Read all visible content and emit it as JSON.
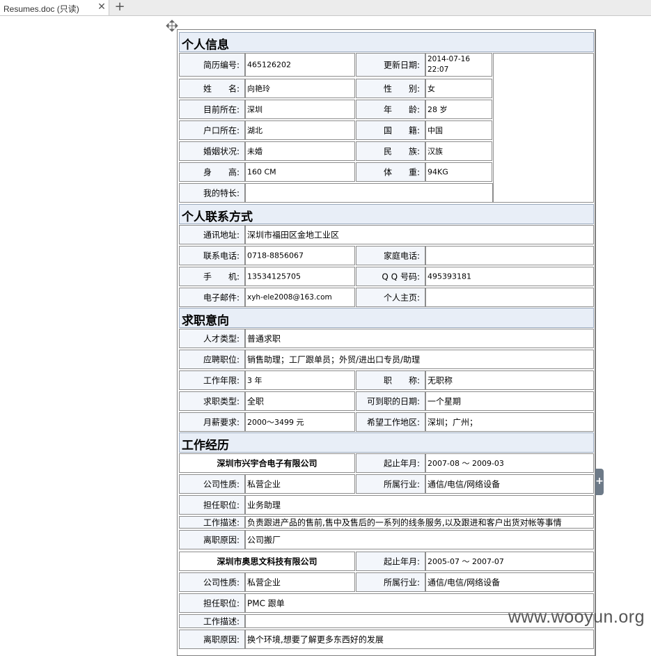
{
  "tab": {
    "title": "Resumes.doc (只读)"
  },
  "side_panel_toggle": "+",
  "watermark": "www.wooyun.org",
  "sections": {
    "personal": "个人信息",
    "contact": "个人联系方式",
    "intention": "求职意向",
    "experience": "工作经历"
  },
  "personal": {
    "id_label": "简历编号:",
    "id": "465126202",
    "updated_label": "更新日期:",
    "updated_date": "2014-07-16",
    "updated_time": "22:07",
    "name_label": "姓　　名:",
    "name": "向艳玲",
    "gender_label": "性　　别:",
    "gender": "女",
    "location_label": "目前所在:",
    "location": "深圳",
    "age_label": "年　　龄:",
    "age": "28 岁",
    "hukou_label": "户口所在:",
    "hukou": "湖北",
    "nationality_label": "国　　籍:",
    "nationality": "中国",
    "marital_label": "婚姻状况:",
    "marital": "未婚",
    "ethnicity_label": "民　　族:",
    "ethnicity": "汉族",
    "height_label": "身　　高:",
    "height": "160 CM",
    "weight_label": "体　　重:",
    "weight": "94KG",
    "specialty_label": "我的特长:",
    "specialty": ""
  },
  "contact": {
    "address_label": "通讯地址:",
    "address": "深圳市福田区金地工业区",
    "phone_label": "联系电话:",
    "phone": "0718-8856067",
    "home_phone_label": "家庭电话:",
    "home_phone": "",
    "mobile_label": "手　　机:",
    "mobile": "13534125705",
    "qq_label": "Q Q 号码:",
    "qq": "495393181",
    "email_label": "电子邮件:",
    "email": "xyh-ele2008@163.com",
    "homepage_label": "个人主页:",
    "homepage": ""
  },
  "intention": {
    "talent_type_label": "人才类型:",
    "talent_type": "普通求职",
    "position_label": "应聘职位:",
    "position": "销售助理；工厂跟单员；外贸/进出口专员/助理",
    "years_label": "工作年限:",
    "years": "3 年",
    "title_label": "职　　称:",
    "title": "无职称",
    "job_type_label": "求职类型:",
    "job_type": "全职",
    "available_label": "可到职的日期:",
    "available": "一个星期",
    "salary_label": "月薪要求:",
    "salary": "2000～3499 元",
    "region_label": "希望工作地区:",
    "region": "深圳；广州；"
  },
  "jobs": [
    {
      "company": "深圳市兴宇合电子有限公司",
      "period_label": "起止年月:",
      "period": "2007-08 ～ 2009-03",
      "nature_label": "公司性质:",
      "nature": "私营企业",
      "industry_label": "所属行业:",
      "industry": "通信/电信/网络设备",
      "role_label": "担任职位:",
      "role": "业务助理",
      "desc_label": "工作描述:",
      "desc": "负责跟进产品的售前,售中及售后的一系列的线条服务,以及跟进和客户出货对帐等事情",
      "leave_label": "离职原因:",
      "leave": "公司搬厂"
    },
    {
      "company": "深圳市奥思文科技有限公司",
      "period_label": "起止年月:",
      "period": "2005-07 ～ 2007-07",
      "nature_label": "公司性质:",
      "nature": "私营企业",
      "industry_label": "所属行业:",
      "industry": "通信/电信/网络设备",
      "role_label": "担任职位:",
      "role": "PMC 跟单",
      "desc_label": "工作描述:",
      "desc": "",
      "leave_label": "离职原因:",
      "leave": "换个环境,想要了解更多东西好的发展"
    }
  ]
}
